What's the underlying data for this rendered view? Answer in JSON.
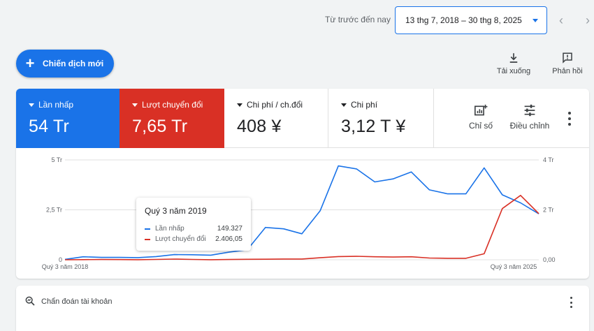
{
  "header": {
    "range_label": "Từ trước đến nay",
    "date_range": "13 thg 7, 2018 – 30 thg 8, 2025"
  },
  "actions": {
    "new_campaign": "Chiến dịch mới",
    "download": "Tải xuống",
    "feedback": "Phản hồi"
  },
  "metrics": [
    {
      "label": "Lần nhấp",
      "value": "54 Tr"
    },
    {
      "label": "Lượt chuyển đổi",
      "value": "7,65 Tr"
    },
    {
      "label": "Chi phí / ch.đổi",
      "value": "408 ¥"
    },
    {
      "label": "Chi phí",
      "value": "3,12 T ¥"
    }
  ],
  "controls": {
    "metrics": "Chỉ số",
    "adjust": "Điều chỉnh"
  },
  "colors": {
    "clicks": "#1a73e8",
    "conversions": "#d93025"
  },
  "chart_data": {
    "type": "line",
    "x_labels": [
      "Quý 3 năm 2018",
      "Quý 3 năm 2025"
    ],
    "y_left_ticks": [
      "0",
      "2,5 Tr",
      "5 Tr"
    ],
    "y_right_ticks": [
      "0,00",
      "2 Tr",
      "4 Tr"
    ],
    "ylim_left": [
      0,
      5000000
    ],
    "ylim_right": [
      0,
      4000000
    ],
    "grid": true,
    "series": [
      {
        "name": "Lần nhấp",
        "axis": "left",
        "values": [
          20000,
          150000,
          120000,
          120000,
          110000,
          160000,
          260000,
          250000,
          230000,
          380000,
          500000,
          1620000,
          1550000,
          1300000,
          2450000,
          4700000,
          4550000,
          3900000,
          4050000,
          4400000,
          3500000,
          3300000,
          3300000,
          4600000,
          3250000,
          2850000,
          2300000
        ]
      },
      {
        "name": "Lượt chuyển đổi",
        "axis": "right",
        "values": [
          0,
          6000,
          12000,
          8000,
          4000,
          14000,
          28000,
          14000,
          2406,
          10000,
          20000,
          22000,
          30000,
          30000,
          80000,
          130000,
          140000,
          120000,
          110000,
          120000,
          70000,
          60000,
          60000,
          240000,
          2050000,
          2580000,
          1850000
        ]
      }
    ],
    "tooltip": {
      "title": "Quý 3 năm 2019",
      "rows": [
        {
          "name": "Lần nhấp",
          "value": "149.327"
        },
        {
          "name": "Lượt chuyển đổi",
          "value": "2.406,05"
        }
      ]
    }
  },
  "diagnostics": {
    "title": "Chẩn đoán tài khoản"
  }
}
